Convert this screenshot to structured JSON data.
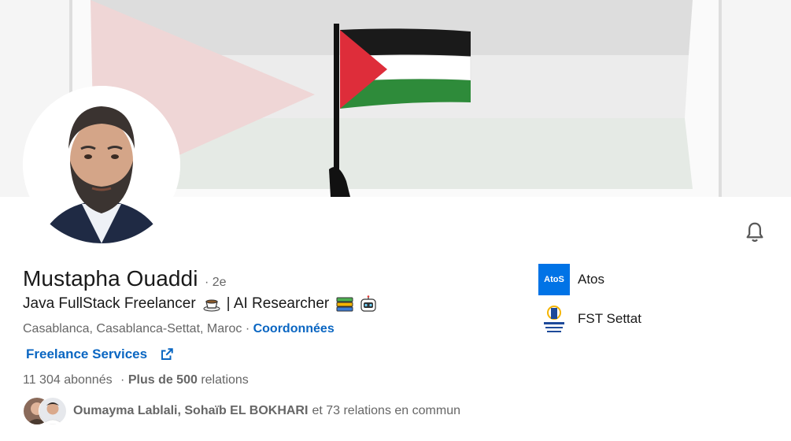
{
  "profile": {
    "name": "Mustapha Ouaddi",
    "degree": "· 2e",
    "headline_part1": "Java FullStack Freelancer",
    "headline_sep": "| AI Researcher",
    "location": "Casablanca, Casablanca-Settat, Maroc ·",
    "contact_link": "Coordonnées",
    "services_link": "Freelance Services",
    "followers": "11 304 abonnés",
    "connections_prefix": "Plus de 500",
    "connections_suffix": "relations",
    "mutual_names": "Oumayma Lablali, Sohaïb EL BOKHARI",
    "mutual_suffix": "et 73 relations en commun"
  },
  "companies": [
    {
      "name": "Atos",
      "logo_text": "AtoS",
      "logo_color": "#0073e6"
    },
    {
      "name": "FST Settat"
    }
  ],
  "icons": {
    "notification": "bell-icon",
    "external": "external-link-icon",
    "emoji1": "coffee-emoji",
    "emoji2": "books-emoji",
    "emoji3": "robot-emoji"
  },
  "colors": {
    "link": "#0a66c2",
    "text": "#191919",
    "muted": "#666666"
  }
}
